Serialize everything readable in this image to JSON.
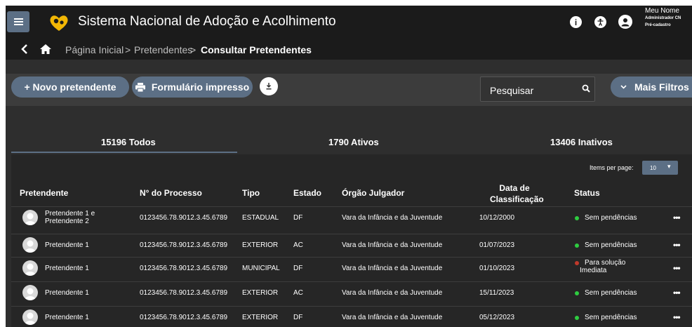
{
  "header": {
    "title": "Sistema Nacional de Adoção e Acolhimento",
    "user_name": "Meu Nome",
    "user_role": "Administrador CN",
    "user_status": "Pré-cadastro",
    "info_icon": "info-icon",
    "accessibility_icon": "accessibility-icon",
    "menu_icon": "hamburger-menu-icon"
  },
  "breadcrumb": {
    "items": [
      "Página Inicial",
      "Pretendentes",
      "Consultar Pretendentes"
    ],
    "separator": ">"
  },
  "toolbar": {
    "new_label": "+ Novo pretendente",
    "print_label": "Formulário impresso",
    "search_placeholder": "Pesquisar",
    "filters_label": "Mais Filtros"
  },
  "tabs": [
    {
      "label": "15196 Todos",
      "active": true
    },
    {
      "label": "1790 Ativos",
      "active": false
    },
    {
      "label": "13406 Inativos",
      "active": false
    }
  ],
  "pagination": {
    "label": "Items per page:",
    "value": "10"
  },
  "table": {
    "columns": [
      "Pretendente",
      "N° do Processo",
      "Tipo",
      "Estado",
      "Órgão Julgador",
      "Data de Classificação",
      "Status"
    ],
    "rows": [
      {
        "name": "Pretendente 1 e Pretendente 2",
        "process": "0123456.78.9012.3.45.6789",
        "tipo": "ESTADUAL",
        "estado": "DF",
        "orgao": "Vara da Infância e da Juventude",
        "data": "10/12/2000",
        "status": "Sem pendências",
        "status_color": "#2ecc40"
      },
      {
        "name": "Pretendente 1",
        "process": "0123456.78.9012.3.45.6789",
        "tipo": "EXTERIOR",
        "estado": "AC",
        "orgao": "Vara da Infância e da Juventude",
        "data": "01/07/2023",
        "status": "Sem pendências",
        "status_color": "#2ecc40"
      },
      {
        "name": "Pretendente 1",
        "process": "0123456.78.9012.3.45.6789",
        "tipo": "MUNICIPAL",
        "estado": "DF",
        "orgao": "Vara da Infância e da Juventude",
        "data": "01/10/2023",
        "status": "Para solução Imediata",
        "status_color": "#c0392b"
      },
      {
        "name": "Pretendente 1",
        "process": "0123456.78.9012.3.45.6789",
        "tipo": "EXTERIOR",
        "estado": "AC",
        "orgao": "Vara da Infância e da Juventude",
        "data": "15/11/2023",
        "status": "Sem pendências",
        "status_color": "#2ecc40"
      },
      {
        "name": "Pretendente 1",
        "process": "0123456.78.9012.3.45.6789",
        "tipo": "EXTERIOR",
        "estado": "DF",
        "orgao": "Vara da Infância e da Juventude",
        "data": "05/12/2023",
        "status": "Sem pendências",
        "status_color": "#2ecc40"
      }
    ],
    "row_actions_label": "•••"
  },
  "colors": {
    "accent": "#5c6f85",
    "logo": "#f2b705",
    "background": "#2e2e2e",
    "header": "#1b1b1b"
  }
}
